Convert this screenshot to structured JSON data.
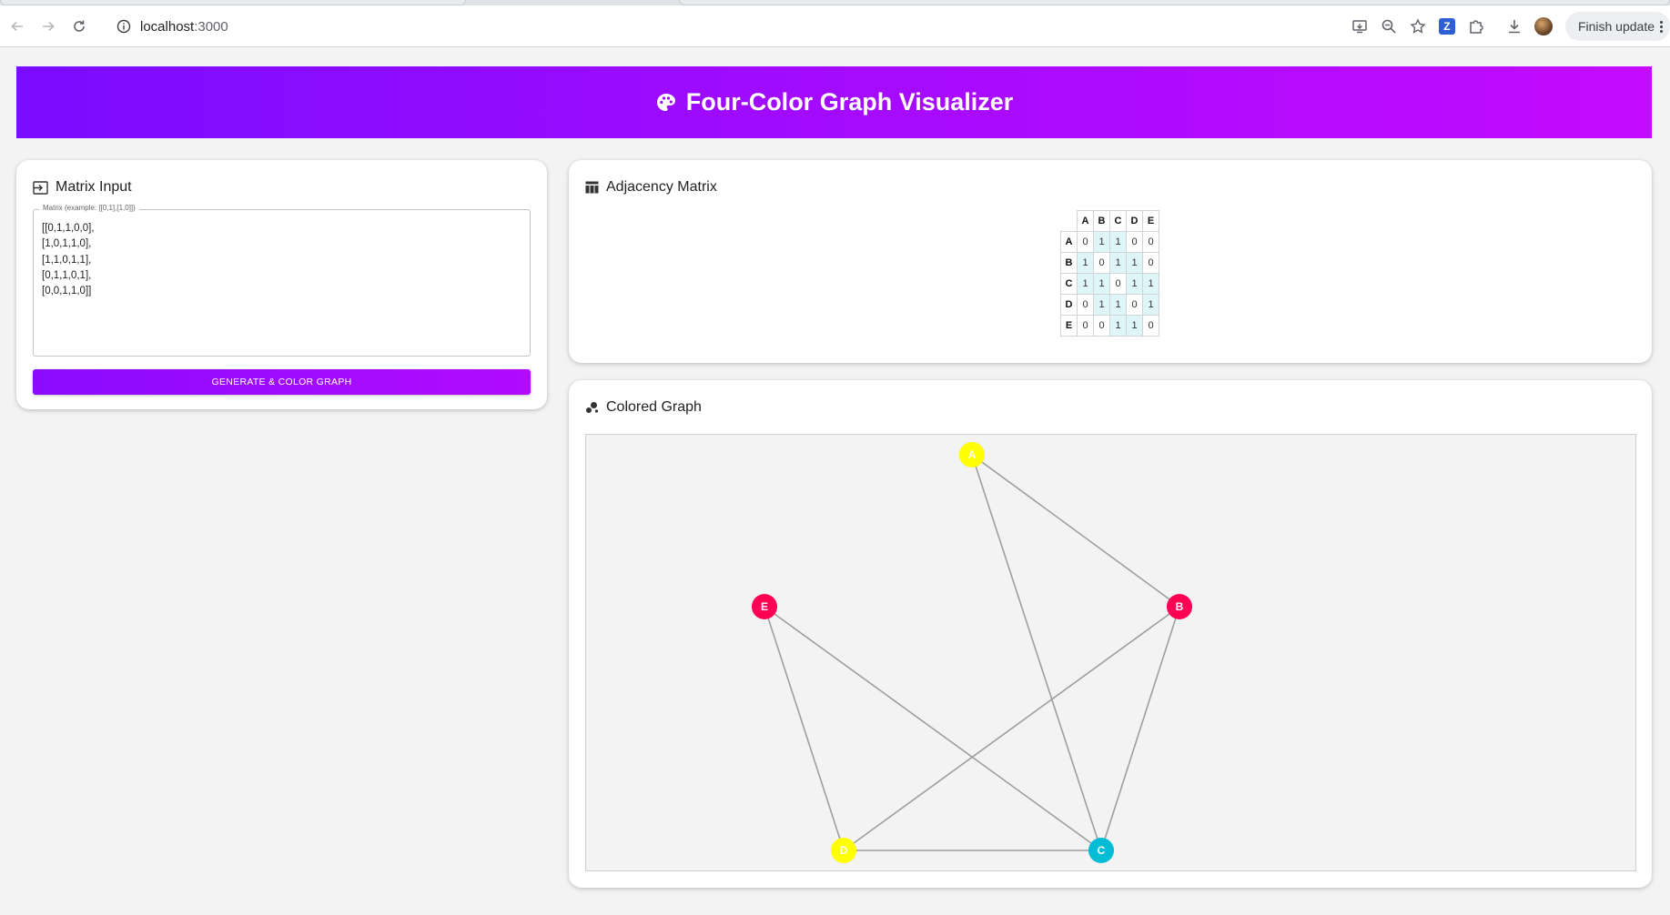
{
  "browser": {
    "url_host": "localhost",
    "url_port": ":3000",
    "finish_update_label": "Finish update"
  },
  "header": {
    "title": "Four-Color Graph Visualizer"
  },
  "matrix_input": {
    "title": "Matrix Input",
    "field_label": "Matrix (example: [[0,1],[1,0]])",
    "value": "[[0,1,1,0,0],\n[1,0,1,1,0],\n[1,1,0,1,1],\n[0,1,1,0,1],\n[0,0,1,1,0]]",
    "button_label": "GENERATE & COLOR GRAPH"
  },
  "adjacency": {
    "title": "Adjacency Matrix",
    "labels": [
      "A",
      "B",
      "C",
      "D",
      "E"
    ],
    "rows": [
      [
        "0",
        "1",
        "1",
        "0",
        "0"
      ],
      [
        "1",
        "0",
        "1",
        "1",
        "0"
      ],
      [
        "1",
        "1",
        "0",
        "1",
        "1"
      ],
      [
        "0",
        "1",
        "1",
        "0",
        "1"
      ],
      [
        "0",
        "0",
        "1",
        "1",
        "0"
      ]
    ]
  },
  "graph": {
    "title": "Colored Graph",
    "nodes": [
      {
        "id": "A",
        "color": "#ffff00"
      },
      {
        "id": "B",
        "color": "#ff0055"
      },
      {
        "id": "C",
        "color": "#00bcd4"
      },
      {
        "id": "D",
        "color": "#ffff00"
      },
      {
        "id": "E",
        "color": "#ff0055"
      }
    ],
    "edges": [
      [
        "A",
        "B"
      ],
      [
        "A",
        "C"
      ],
      [
        "B",
        "C"
      ],
      [
        "B",
        "D"
      ],
      [
        "C",
        "D"
      ],
      [
        "C",
        "E"
      ],
      [
        "D",
        "E"
      ]
    ]
  }
}
